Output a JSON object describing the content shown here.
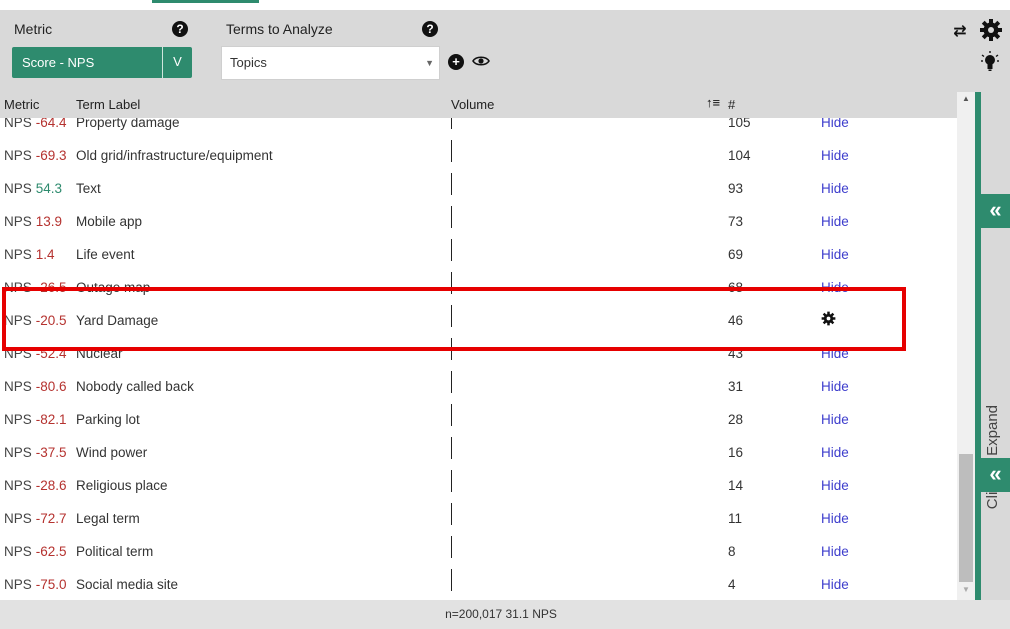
{
  "controls": {
    "metric_label": "Metric",
    "metric_value": "Score - NPS",
    "metric_caret": "V",
    "terms_label": "Terms to Analyze",
    "terms_value": "Topics",
    "help_glyph": "?",
    "plus_glyph": "+",
    "refresh_glyph": "⇄"
  },
  "table": {
    "headers": {
      "metric": "Metric",
      "term": "Term Label",
      "volume": "Volume",
      "count": "#"
    },
    "sort_glyph": "↑≡",
    "nps_prefix": "NPS",
    "rows": [
      {
        "score": "-64.4",
        "sign": "neg",
        "label": "Property damage",
        "count": "105",
        "action": "Hide"
      },
      {
        "score": "-69.3",
        "sign": "neg",
        "label": "Old grid/infrastructure/equipment",
        "count": "104",
        "action": "Hide"
      },
      {
        "score": "54.3",
        "sign": "pos",
        "label": "Text",
        "count": "93",
        "action": "Hide"
      },
      {
        "score": "13.9",
        "sign": "neg",
        "label": "Mobile app",
        "count": "73",
        "action": "Hide"
      },
      {
        "score": "1.4",
        "sign": "neg",
        "label": "Life event",
        "count": "69",
        "action": "Hide"
      },
      {
        "score": "-26.5",
        "sign": "neg",
        "label": "Outage map",
        "count": "68",
        "action": "Hide"
      },
      {
        "score": "-20.5",
        "sign": "neg",
        "label": "Yard Damage",
        "count": "46",
        "action": ""
      },
      {
        "score": "-52.4",
        "sign": "neg",
        "label": "Nuclear",
        "count": "43",
        "action": "Hide"
      },
      {
        "score": "-80.6",
        "sign": "neg",
        "label": "Nobody called back",
        "count": "31",
        "action": "Hide"
      },
      {
        "score": "-82.1",
        "sign": "neg",
        "label": "Parking lot",
        "count": "28",
        "action": "Hide"
      },
      {
        "score": "-37.5",
        "sign": "neg",
        "label": "Wind power",
        "count": "16",
        "action": "Hide"
      },
      {
        "score": "-28.6",
        "sign": "neg",
        "label": "Religious place",
        "count": "14",
        "action": "Hide"
      },
      {
        "score": "-72.7",
        "sign": "neg",
        "label": "Legal term",
        "count": "11",
        "action": "Hide"
      },
      {
        "score": "-62.5",
        "sign": "neg",
        "label": "Political term",
        "count": "8",
        "action": "Hide"
      },
      {
        "score": "-75.0",
        "sign": "neg",
        "label": "Social media site",
        "count": "4",
        "action": "Hide"
      }
    ]
  },
  "side_panel": {
    "expand_text": "Click to Expand",
    "chevron_glyph": "«"
  },
  "footer": {
    "summary": "n=200,017  31.1 NPS"
  },
  "colors": {
    "accent": "#2e8b6e",
    "negative": "#b5322f",
    "positive": "#2e8b6e",
    "link": "#3d3dcc",
    "highlight": "#e60000"
  }
}
